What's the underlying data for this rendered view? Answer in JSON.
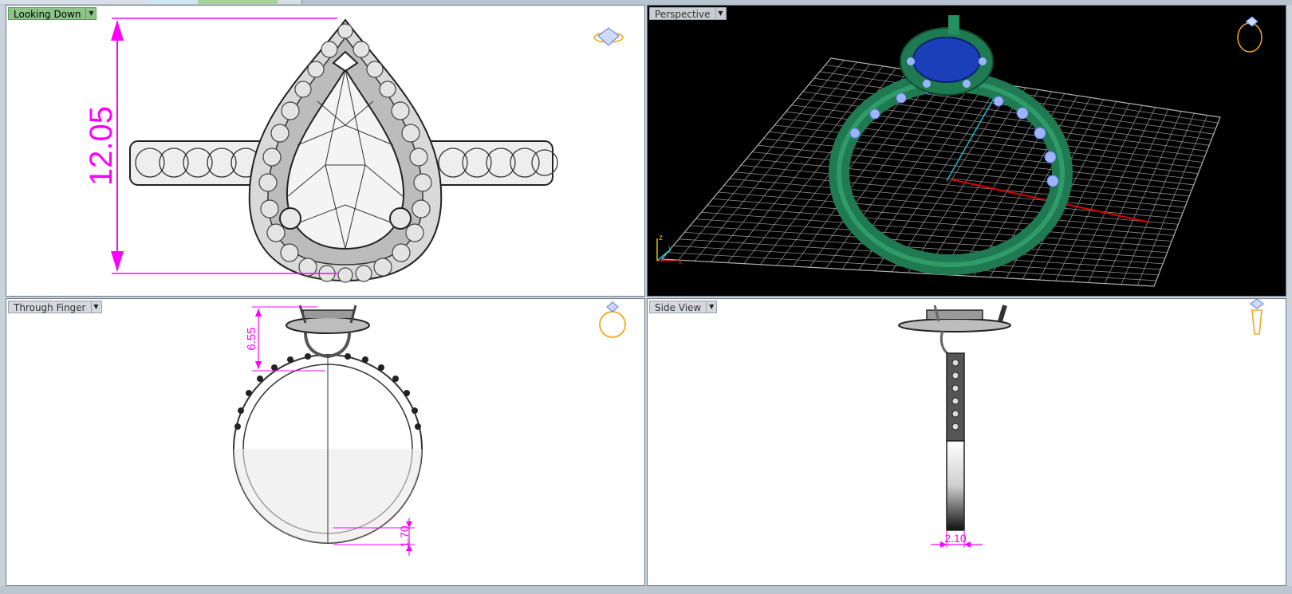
{
  "viewports": {
    "top_left": {
      "label": "Looking Down",
      "dimension": "12.05"
    },
    "top_right": {
      "label": "Perspective",
      "axis_z": "z",
      "axis_y": "y",
      "axis_x": "x"
    },
    "bottom_left": {
      "label": "Through Finger",
      "dimension_top": "6.55",
      "dimension_bottom": "1.70"
    },
    "bottom_right": {
      "label": "Side View",
      "dimension": "2.10"
    }
  },
  "colors": {
    "dimension": "#ff00ff",
    "ring_green": "#1f7a52",
    "stone_blue": "#1a3fb8",
    "accent_stone": "#9fb4ff",
    "icon_gold": "#f2a81e",
    "grid": "#9a9a9a"
  }
}
